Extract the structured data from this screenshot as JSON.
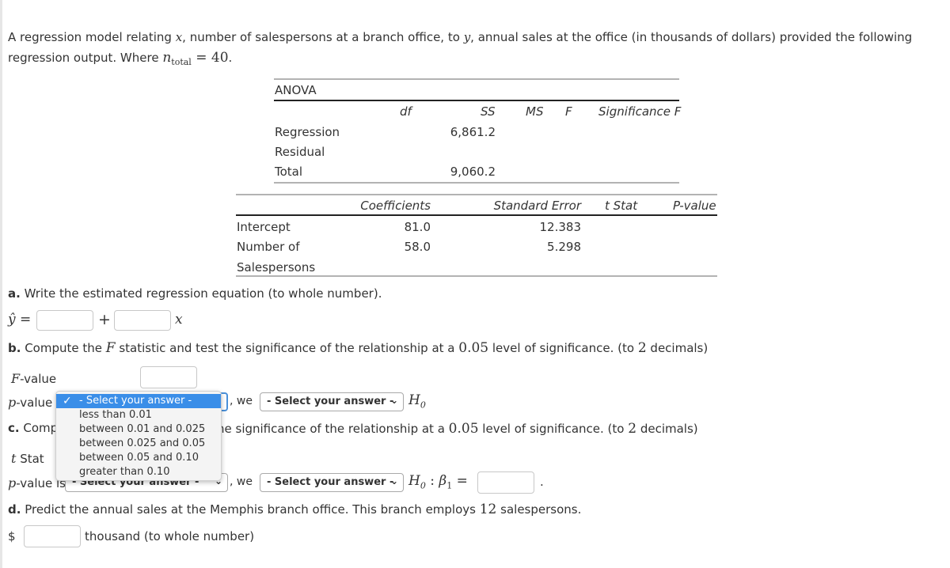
{
  "intro": {
    "line1_a": "A regression model relating ",
    "var_x": "x",
    "line1_b": ", number of salespersons at a branch office, to ",
    "var_y": "y",
    "line1_c": ", annual sales at the office (in thousands of dollars) provided the following",
    "line2_a": "regression output. Where ",
    "n_label": "n",
    "n_sub": "total",
    "n_eq": " = 40",
    "line2_end": "."
  },
  "anova": {
    "title": "ANOVA",
    "headers": [
      "df",
      "SS",
      "MS",
      "F",
      "Significance F"
    ],
    "rows": [
      {
        "label": "Regression",
        "df": "",
        "ss": "6,861.2",
        "ms": "",
        "f": "",
        "sig": ""
      },
      {
        "label": "Residual",
        "df": "",
        "ss": "",
        "ms": "",
        "f": "",
        "sig": ""
      },
      {
        "label": "Total",
        "df": "",
        "ss": "9,060.2",
        "ms": "",
        "f": "",
        "sig": ""
      }
    ]
  },
  "coef": {
    "headers": [
      "Coefficients",
      "Standard Error",
      "t Stat",
      "P-value"
    ],
    "rows": [
      {
        "label": "Intercept",
        "label2": "",
        "coef": "81.0",
        "se": "12.383",
        "t": "",
        "p": ""
      },
      {
        "label": "Number of",
        "label2": "Salespersons",
        "coef": "58.0",
        "se": "5.298",
        "t": "",
        "p": ""
      }
    ]
  },
  "part_a": {
    "marker": "a.",
    "text": " Write the estimated regression equation (to whole number).",
    "yhat": "ŷ",
    "equals": "=",
    "plus": "+",
    "x": "x",
    "b0_value": "",
    "b1_value": ""
  },
  "part_b": {
    "marker": "b.",
    "text_a": " Compute the ",
    "F": "F",
    "text_b": " statistic and test the significance of the relationship at a ",
    "alpha": "0.05",
    "text_c": " level of significance. (to ",
    "dec": "2",
    "text_d": " decimals)",
    "fvalue_label_var": "F",
    "fvalue_label": "-value",
    "fvalue_value": "",
    "pvalue_var": "p",
    "pvalue_label": "-value i",
    "we": ", we",
    "h0": "H",
    "h0_sub": "0",
    "conclusion_select": "- Select your answer -",
    "dropdown_options": [
      "- Select your answer -",
      "less than 0.01",
      "between 0.01 and 0.025",
      "between 0.025 and 0.05",
      "between 0.05 and 0.10",
      "greater than 0.10"
    ],
    "dropdown_selected_index": 0
  },
  "part_c": {
    "marker": "c.",
    "text_visible_a": " Compu",
    "text_visible_b": "he significance of the relationship at a ",
    "alpha": "0.05",
    "text_c": " level of significance. (to ",
    "dec": "2",
    "text_d": " decimals)",
    "tstat_var": "t",
    "tstat_label": " Stat",
    "pvalue_var": "p",
    "pvalue_label": "-value is",
    "pvalue_select": "- Select your answer -",
    "we": ", we",
    "conclusion_select": "- Select your answer -",
    "h0": "H",
    "h0_sub": "0",
    "colon": " : ",
    "beta": "β",
    "beta_sub": "1",
    "equals": " =",
    "beta_value": "",
    "period": "."
  },
  "part_d": {
    "marker": "d.",
    "text_a": " Predict the annual sales at the Memphis branch office. This branch employs ",
    "n": "12",
    "text_b": " salespersons.",
    "dollar": "$",
    "value": "",
    "unit": "thousand (to whole number)"
  }
}
